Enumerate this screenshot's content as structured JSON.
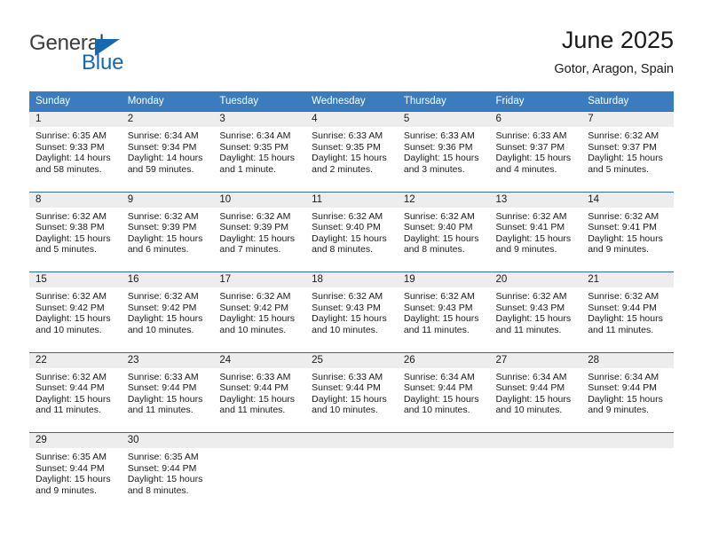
{
  "brand": {
    "word1": "General",
    "word2": "Blue",
    "accent_color": "#1668b3"
  },
  "header": {
    "title": "June 2025",
    "location": "Gotor, Aragon, Spain"
  },
  "calendar": {
    "header_bg": "#3a7cbe",
    "row_border": "#2f6ca8",
    "daynum_bg": "#ededed",
    "weekdays": [
      "Sunday",
      "Monday",
      "Tuesday",
      "Wednesday",
      "Thursday",
      "Friday",
      "Saturday"
    ],
    "weeks": [
      [
        {
          "day": "1",
          "lines": [
            "Sunrise: 6:35 AM",
            "Sunset: 9:33 PM",
            "Daylight: 14 hours",
            "and 58 minutes."
          ]
        },
        {
          "day": "2",
          "lines": [
            "Sunrise: 6:34 AM",
            "Sunset: 9:34 PM",
            "Daylight: 14 hours",
            "and 59 minutes."
          ]
        },
        {
          "day": "3",
          "lines": [
            "Sunrise: 6:34 AM",
            "Sunset: 9:35 PM",
            "Daylight: 15 hours",
            "and 1 minute."
          ]
        },
        {
          "day": "4",
          "lines": [
            "Sunrise: 6:33 AM",
            "Sunset: 9:35 PM",
            "Daylight: 15 hours",
            "and 2 minutes."
          ]
        },
        {
          "day": "5",
          "lines": [
            "Sunrise: 6:33 AM",
            "Sunset: 9:36 PM",
            "Daylight: 15 hours",
            "and 3 minutes."
          ]
        },
        {
          "day": "6",
          "lines": [
            "Sunrise: 6:33 AM",
            "Sunset: 9:37 PM",
            "Daylight: 15 hours",
            "and 4 minutes."
          ]
        },
        {
          "day": "7",
          "lines": [
            "Sunrise: 6:32 AM",
            "Sunset: 9:37 PM",
            "Daylight: 15 hours",
            "and 5 minutes."
          ]
        }
      ],
      [
        {
          "day": "8",
          "lines": [
            "Sunrise: 6:32 AM",
            "Sunset: 9:38 PM",
            "Daylight: 15 hours",
            "and 5 minutes."
          ]
        },
        {
          "day": "9",
          "lines": [
            "Sunrise: 6:32 AM",
            "Sunset: 9:39 PM",
            "Daylight: 15 hours",
            "and 6 minutes."
          ]
        },
        {
          "day": "10",
          "lines": [
            "Sunrise: 6:32 AM",
            "Sunset: 9:39 PM",
            "Daylight: 15 hours",
            "and 7 minutes."
          ]
        },
        {
          "day": "11",
          "lines": [
            "Sunrise: 6:32 AM",
            "Sunset: 9:40 PM",
            "Daylight: 15 hours",
            "and 8 minutes."
          ]
        },
        {
          "day": "12",
          "lines": [
            "Sunrise: 6:32 AM",
            "Sunset: 9:40 PM",
            "Daylight: 15 hours",
            "and 8 minutes."
          ]
        },
        {
          "day": "13",
          "lines": [
            "Sunrise: 6:32 AM",
            "Sunset: 9:41 PM",
            "Daylight: 15 hours",
            "and 9 minutes."
          ]
        },
        {
          "day": "14",
          "lines": [
            "Sunrise: 6:32 AM",
            "Sunset: 9:41 PM",
            "Daylight: 15 hours",
            "and 9 minutes."
          ]
        }
      ],
      [
        {
          "day": "15",
          "lines": [
            "Sunrise: 6:32 AM",
            "Sunset: 9:42 PM",
            "Daylight: 15 hours",
            "and 10 minutes."
          ]
        },
        {
          "day": "16",
          "lines": [
            "Sunrise: 6:32 AM",
            "Sunset: 9:42 PM",
            "Daylight: 15 hours",
            "and 10 minutes."
          ]
        },
        {
          "day": "17",
          "lines": [
            "Sunrise: 6:32 AM",
            "Sunset: 9:42 PM",
            "Daylight: 15 hours",
            "and 10 minutes."
          ]
        },
        {
          "day": "18",
          "lines": [
            "Sunrise: 6:32 AM",
            "Sunset: 9:43 PM",
            "Daylight: 15 hours",
            "and 10 minutes."
          ]
        },
        {
          "day": "19",
          "lines": [
            "Sunrise: 6:32 AM",
            "Sunset: 9:43 PM",
            "Daylight: 15 hours",
            "and 11 minutes."
          ]
        },
        {
          "day": "20",
          "lines": [
            "Sunrise: 6:32 AM",
            "Sunset: 9:43 PM",
            "Daylight: 15 hours",
            "and 11 minutes."
          ]
        },
        {
          "day": "21",
          "lines": [
            "Sunrise: 6:32 AM",
            "Sunset: 9:44 PM",
            "Daylight: 15 hours",
            "and 11 minutes."
          ]
        }
      ],
      [
        {
          "day": "22",
          "lines": [
            "Sunrise: 6:32 AM",
            "Sunset: 9:44 PM",
            "Daylight: 15 hours",
            "and 11 minutes."
          ]
        },
        {
          "day": "23",
          "lines": [
            "Sunrise: 6:33 AM",
            "Sunset: 9:44 PM",
            "Daylight: 15 hours",
            "and 11 minutes."
          ]
        },
        {
          "day": "24",
          "lines": [
            "Sunrise: 6:33 AM",
            "Sunset: 9:44 PM",
            "Daylight: 15 hours",
            "and 11 minutes."
          ]
        },
        {
          "day": "25",
          "lines": [
            "Sunrise: 6:33 AM",
            "Sunset: 9:44 PM",
            "Daylight: 15 hours",
            "and 10 minutes."
          ]
        },
        {
          "day": "26",
          "lines": [
            "Sunrise: 6:34 AM",
            "Sunset: 9:44 PM",
            "Daylight: 15 hours",
            "and 10 minutes."
          ]
        },
        {
          "day": "27",
          "lines": [
            "Sunrise: 6:34 AM",
            "Sunset: 9:44 PM",
            "Daylight: 15 hours",
            "and 10 minutes."
          ]
        },
        {
          "day": "28",
          "lines": [
            "Sunrise: 6:34 AM",
            "Sunset: 9:44 PM",
            "Daylight: 15 hours",
            "and 9 minutes."
          ]
        }
      ],
      [
        {
          "day": "29",
          "lines": [
            "Sunrise: 6:35 AM",
            "Sunset: 9:44 PM",
            "Daylight: 15 hours",
            "and 9 minutes."
          ]
        },
        {
          "day": "30",
          "lines": [
            "Sunrise: 6:35 AM",
            "Sunset: 9:44 PM",
            "Daylight: 15 hours",
            "and 8 minutes."
          ]
        },
        {
          "day": "",
          "lines": []
        },
        {
          "day": "",
          "lines": []
        },
        {
          "day": "",
          "lines": []
        },
        {
          "day": "",
          "lines": []
        },
        {
          "day": "",
          "lines": []
        }
      ]
    ]
  }
}
